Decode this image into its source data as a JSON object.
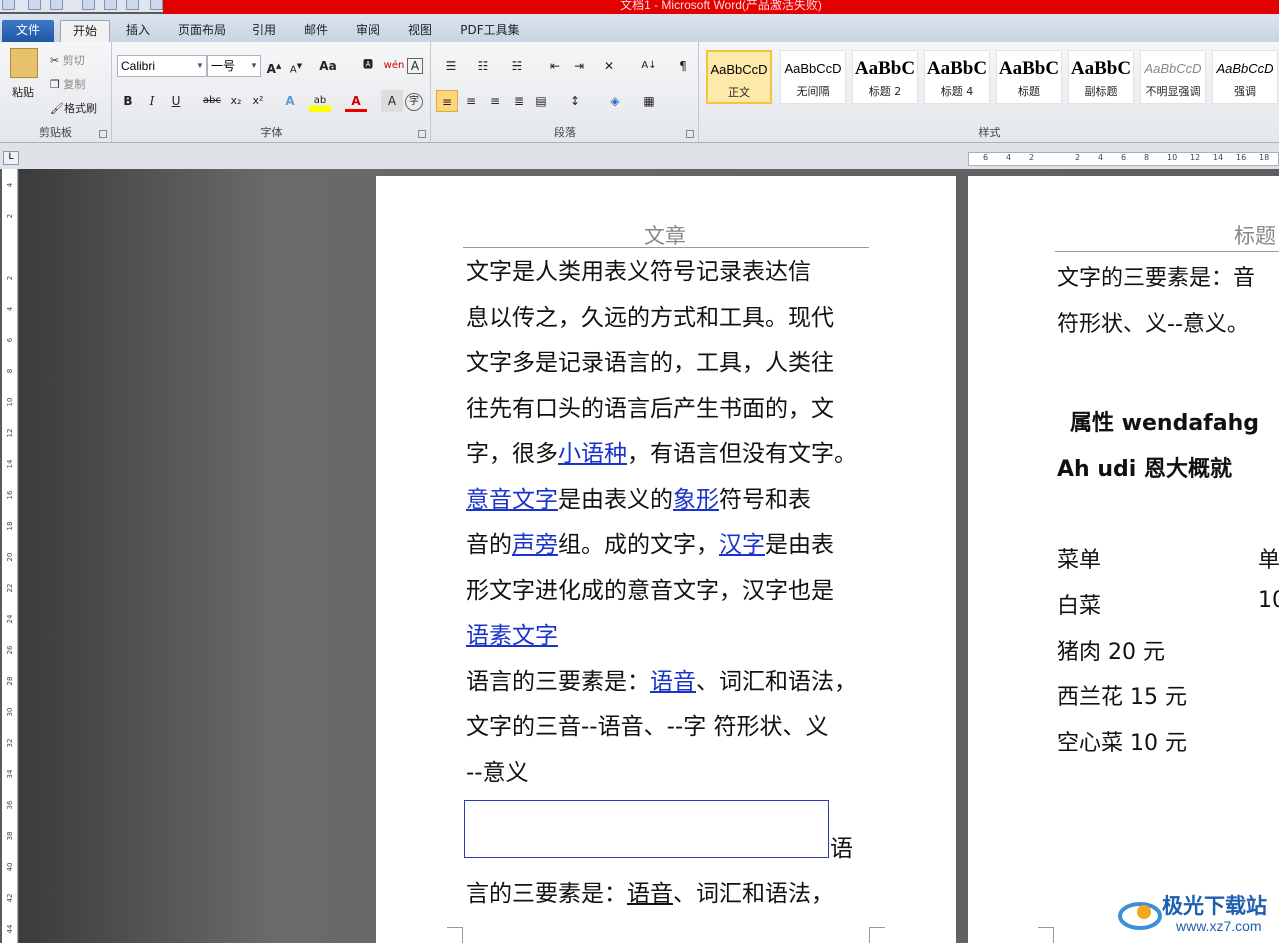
{
  "window": {
    "title": "文档1 - Microsoft Word(产品激活失败)"
  },
  "tabs": [
    "文件",
    "开始",
    "插入",
    "页面布局",
    "引用",
    "邮件",
    "审阅",
    "视图",
    "PDF工具集"
  ],
  "clipboard": {
    "paste": "粘贴",
    "cut": "剪切",
    "copy": "复制",
    "format_painter": "格式刷",
    "label": "剪贴板"
  },
  "font": {
    "name": "Calibri",
    "size": "一号",
    "label": "字体"
  },
  "paragraph": {
    "label": "段落"
  },
  "styles": {
    "label": "样式",
    "items": [
      {
        "sample": "AaBbCcD",
        "name": "正文"
      },
      {
        "sample": "AaBbCcD",
        "name": "无间隔"
      },
      {
        "sample": "AaBbC",
        "name": "标题 2"
      },
      {
        "sample": "AaBbC",
        "name": "标题 4"
      },
      {
        "sample": "AaBbC",
        "name": "标题"
      },
      {
        "sample": "AaBbC",
        "name": "副标题"
      },
      {
        "sample": "AaBbCcD",
        "name": "不明显强调"
      },
      {
        "sample": "AaBbCcD",
        "name": "强调"
      }
    ]
  },
  "page1": {
    "header": "文章",
    "lines": [
      "文字是人类用表义符号记录表达信",
      "息以传之，久远的方式和工具。现代",
      "文字多是记录语言的，工具，人类往",
      "往先有口头的语言后产生书面的，文"
    ],
    "line5": {
      "a": "字，很多",
      "link": "小语种",
      "b": "，有语言但没有文字。"
    },
    "line6": {
      "link1": "意音文字",
      "a": "是由表义的",
      "link2": "象形",
      "b": "符号和表"
    },
    "line7": {
      "a": "音的",
      "link1": "声旁",
      "b": "组。成的文字，",
      "link2": "汉字",
      "c": "是由表"
    },
    "line8": "形文字进化成的意音文字，汉字也是",
    "line9_link": "语素文字",
    "line10": {
      "a": "语言的三要素是：",
      "link": "语音",
      "b": "、词汇和语法，"
    },
    "line11": "文字的三音--语音、--字  符形状、义",
    "line12": "--意义",
    "after_box": "语",
    "line13": {
      "a": "言的三要素是：",
      "u": "语音",
      "b": "、词汇和语法，"
    }
  },
  "page2": {
    "header": "标题",
    "line1": "文字的三要素是：音",
    "line2": "符形状、义--意义。",
    "attr": "属性 wendafahg",
    "ah": "Ah udi 恩大概就",
    "table": [
      [
        "菜单",
        "单"
      ],
      [
        "白菜",
        "10"
      ],
      [
        "猪肉 20 元",
        ""
      ],
      [
        "西兰花 15 元",
        ""
      ],
      [
        "空心菜 10 元",
        ""
      ]
    ]
  },
  "watermark": {
    "brand": "极光下载站",
    "url": "www.xz7.com"
  },
  "ruler_h": [
    "6",
    "4",
    "2",
    "",
    "2",
    "4",
    "6",
    "8",
    "10",
    "12",
    "14",
    "16",
    "18"
  ],
  "ruler_v": [
    "4",
    "2",
    "",
    "2",
    "4",
    "6",
    "8",
    "10",
    "12",
    "14",
    "16",
    "18",
    "20",
    "22",
    "24",
    "26",
    "28",
    "30",
    "32",
    "34",
    "36",
    "38",
    "40",
    "42",
    "44"
  ]
}
